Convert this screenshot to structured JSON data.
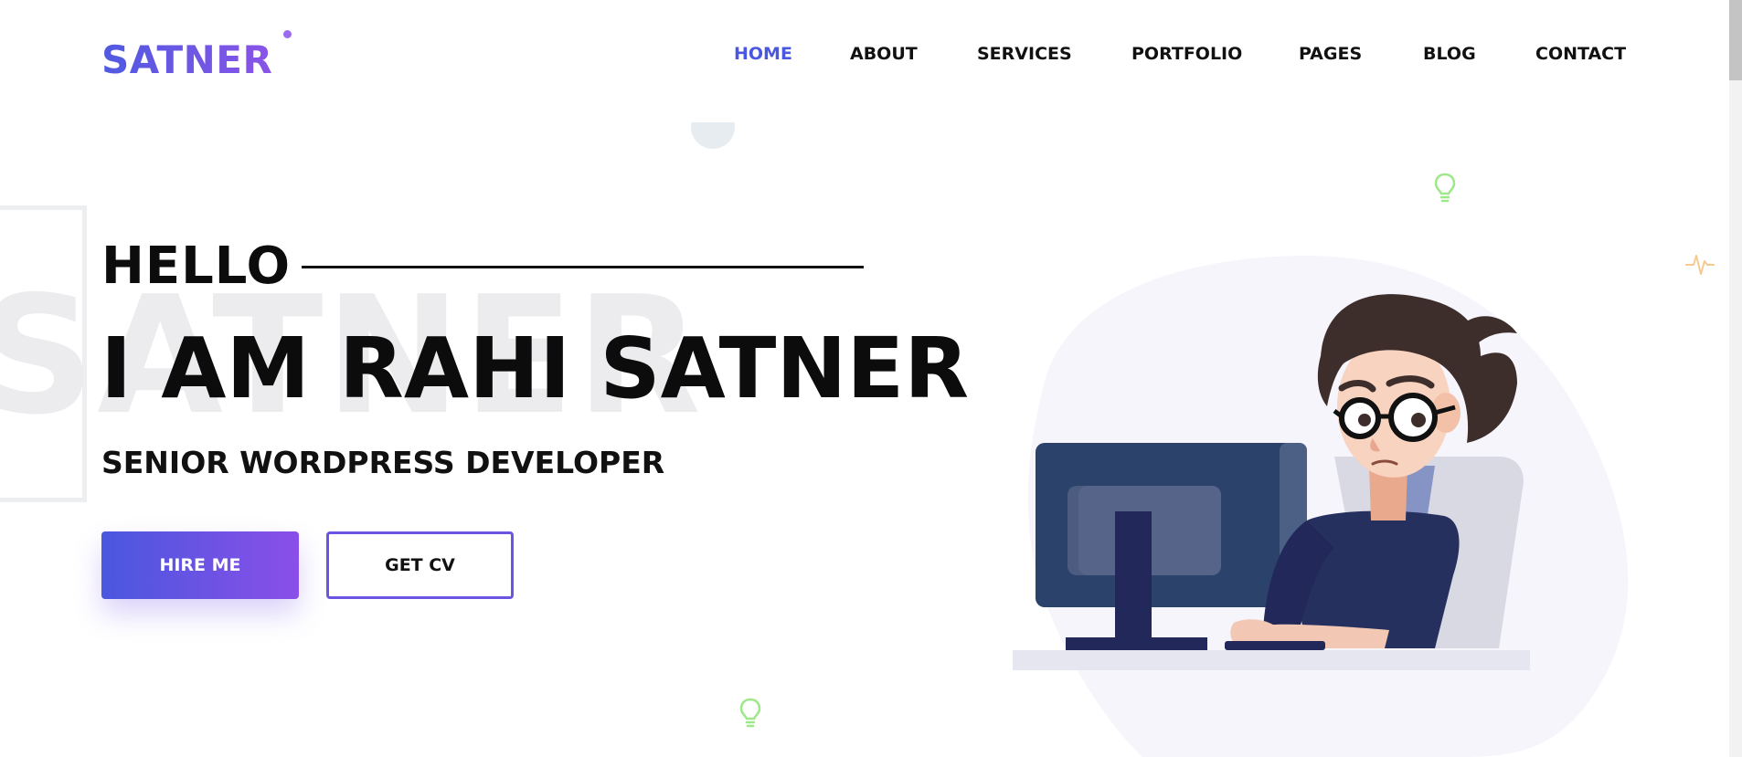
{
  "brand": {
    "logo_text": "SATNER",
    "accent_color": "#4a57df",
    "gradient_end_color": "#8a4fe8"
  },
  "nav": {
    "items": [
      {
        "label": "HOME",
        "active": true
      },
      {
        "label": "ABOUT",
        "active": false
      },
      {
        "label": "SERVICES",
        "active": false
      },
      {
        "label": "PORTFOLIO",
        "active": false
      },
      {
        "label": "PAGES",
        "active": false
      },
      {
        "label": "BLOG",
        "active": false
      },
      {
        "label": "CONTACT",
        "active": false
      }
    ]
  },
  "hero": {
    "background_word": "SATNER",
    "greeting": "HELLO",
    "headline": "I AM RAHI SATNER",
    "subtitle": "SENIOR WORDPRESS DEVELOPER",
    "primary_button": "HIRE ME",
    "secondary_button": "GET CV"
  },
  "decorations": {
    "icons": [
      "lightbulb-icon",
      "pulse-icon",
      "lightbulb-icon"
    ]
  },
  "illustration": {
    "subject": "developer-at-computer-illustration"
  }
}
